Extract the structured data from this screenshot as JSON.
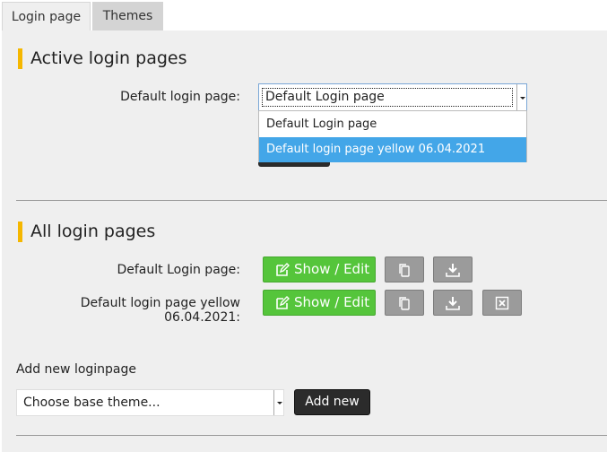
{
  "tabs": [
    {
      "label": "Login page",
      "active": true
    },
    {
      "label": "Themes",
      "active": false
    }
  ],
  "active_section": {
    "title": "Active login pages",
    "default_label": "Default login page:",
    "default_value": "Default Login page",
    "dropdown_options": [
      "Default Login page",
      "Default login page yellow 06.04.2021"
    ],
    "dropdown_highlighted_index": 1
  },
  "all_section": {
    "title": "All login pages",
    "rows": [
      {
        "label": "Default Login page:",
        "show_edit_label": "Show / Edit",
        "actions": [
          "copy-icon",
          "download-icon"
        ]
      },
      {
        "label": "Default login page yellow 06.04.2021:",
        "show_edit_label": "Show / Edit",
        "actions": [
          "copy-icon",
          "download-icon",
          "delete-icon"
        ]
      }
    ]
  },
  "add_new": {
    "label": "Add new loginpage",
    "select_value": "Choose base theme...",
    "button_label": "Add new"
  },
  "colors": {
    "accent_bar": "#f5b700",
    "green_button": "#55c53b",
    "gray_button": "#9b9b9b",
    "dark_button": "#2b2b2b",
    "highlight": "#43a6e8"
  }
}
